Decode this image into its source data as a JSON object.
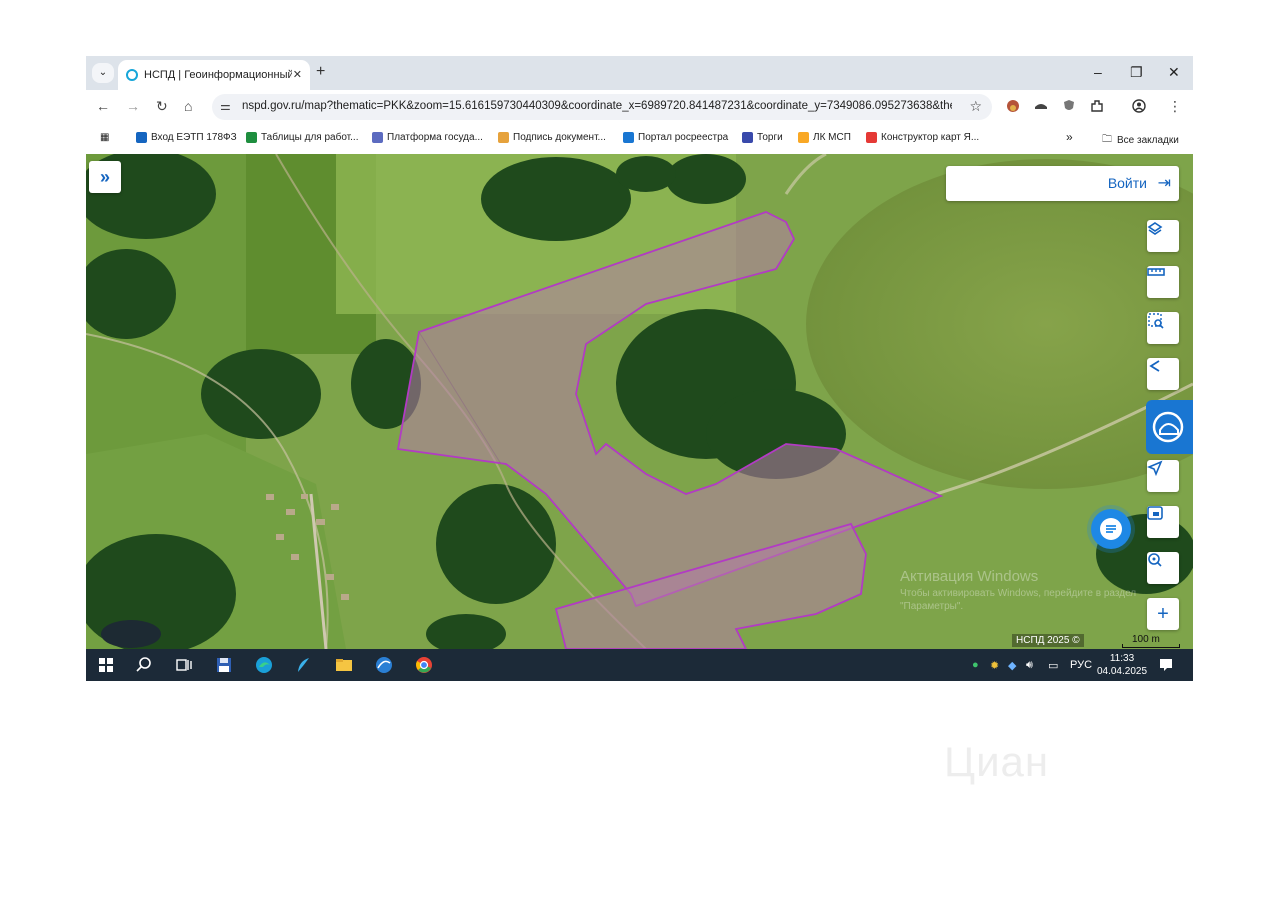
{
  "browser": {
    "tab_title": "НСПД | Геоинформационный",
    "tab_close": "✕",
    "new_tab": "+",
    "window_minimize": "–",
    "window_restore": "❐",
    "window_close": "✕",
    "url": "nspd.gov.ru/map?thematic=PKK&zoom=15.616159730440309&coordinate_x=6989720.841487231&coordinate_y=7349086.095273638&the...",
    "bookmarks": [
      {
        "label": "Вход ЕЭТП 178ФЗ",
        "color": "#1565c0"
      },
      {
        "label": "Таблицы для работ...",
        "color": "#1e8e3e"
      },
      {
        "label": "Платформа госуда...",
        "color": "#5c6bc0"
      },
      {
        "label": "Подпись документ...",
        "color": "#e6a23c"
      },
      {
        "label": "Портал росреестра",
        "color": "#1976d2"
      },
      {
        "label": "Торги",
        "color": "#3949ab"
      },
      {
        "label": "ЛК МСП",
        "color": "#f9a825"
      },
      {
        "label": "Конструктор карт Я...",
        "color": "#e53935"
      }
    ],
    "bookmarks_more": "»",
    "all_bookmarks": "Все закладки"
  },
  "map": {
    "login_label": "Войти",
    "expand_icon": "»",
    "attribution": "НСПД 2025 ©",
    "scale_label": "100 m",
    "activation_title": "Активация Windows",
    "activation_text": "Чтобы активировать Windows, перейдите в раздел \"Параметры\".",
    "plot_color": "#b23bc4"
  },
  "taskbar": {
    "language": "РУС",
    "time": "11:33",
    "date": "04.04.2025"
  },
  "watermark": "Циан"
}
